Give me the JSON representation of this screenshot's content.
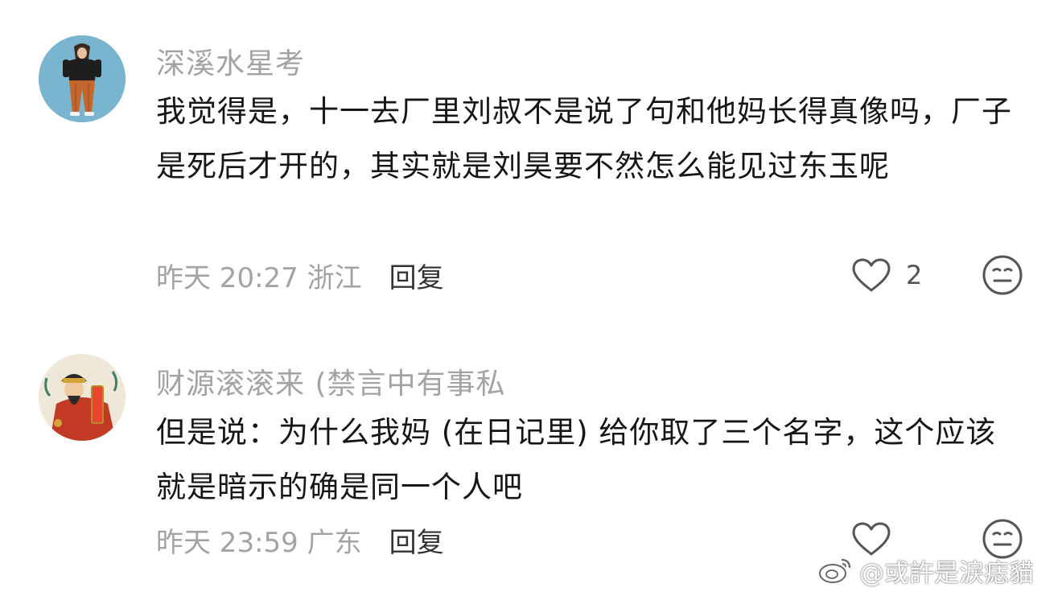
{
  "comments": [
    {
      "username": "深溪水星考",
      "content": "我觉得是，十一去厂里刘叔不是说了句和他妈长得真像吗，厂子是死后才开的，其实就是刘昊要不然怎么能见过东玉呢",
      "meta": "昨天 20:27 浙江",
      "reply_label": "回复",
      "like_count": "2",
      "avatar_icon": "avatar-person-icon"
    },
    {
      "username": "财源滚滚来 (禁言中有事私",
      "content": "但是说：为什么我妈 (在日记里) 给你取了三个名字，这个应该就是暗示的确是同一个人吧",
      "meta": "昨天 23:59 广东",
      "reply_label": "回复",
      "like_count": "",
      "avatar_icon": "avatar-deity-icon"
    }
  ],
  "watermark": "@或許是淚痣貓",
  "colors": {
    "username": "#a3a3a3",
    "content": "#161616",
    "reply": "#333333",
    "icon": "#555555"
  }
}
